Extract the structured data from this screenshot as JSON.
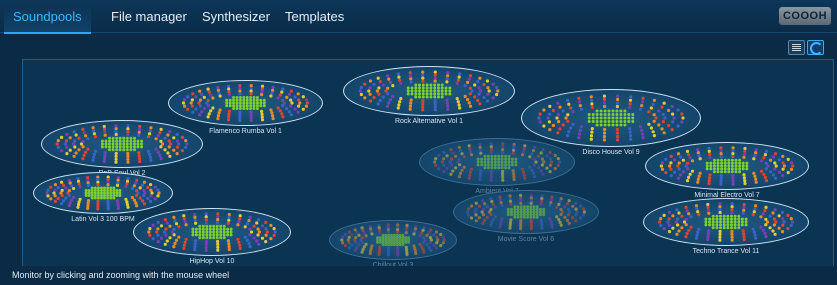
{
  "tabs": [
    {
      "label": "Soundpools",
      "active": true
    },
    {
      "label": "File manager",
      "active": false
    },
    {
      "label": "Synthesizer",
      "active": false
    },
    {
      "label": "Templates",
      "active": false
    }
  ],
  "brand": "COOOH",
  "view_buttons": [
    {
      "icon": "list-icon",
      "active": false
    },
    {
      "icon": "spiral-icon",
      "active": true
    }
  ],
  "soundpools": [
    {
      "label": "Flamenco Rumba Vol 1",
      "dim": false
    },
    {
      "label": "Rock Alternative Vol 1",
      "dim": false
    },
    {
      "label": "Disco House Vol 9",
      "dim": false
    },
    {
      "label": "RnB Soul Vol 2",
      "dim": false
    },
    {
      "label": "Ambient Vol 7",
      "dim": true
    },
    {
      "label": "Minimal Electro Vol 7",
      "dim": false
    },
    {
      "label": "Latin Vol 3 100 BPM",
      "dim": false
    },
    {
      "label": "Movie Score Vol 6",
      "dim": true
    },
    {
      "label": "Techno Trance Vol 11",
      "dim": false
    },
    {
      "label": "HipHop Vol 10",
      "dim": false
    },
    {
      "label": "Chillout Vol 3",
      "dim": true
    }
  ],
  "colors": {
    "accent": "#2da6ff",
    "dot_center": "#7ccf2e",
    "dot_ring_red": "#e0432f",
    "dot_ring_orange": "#ef8a23",
    "dot_ring_yellow": "#e6c936",
    "dot_ring_purple": "#7b3fb5",
    "dot_ring_blue": "#3a63c9"
  },
  "status": "Monitor by clicking and zooming with the mouse wheel"
}
